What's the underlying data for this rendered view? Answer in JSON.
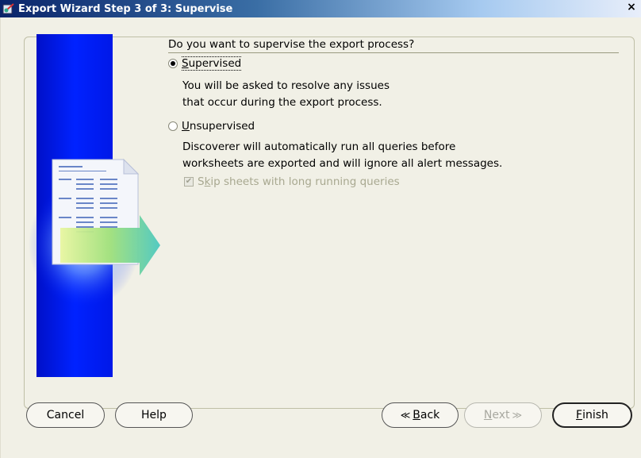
{
  "window": {
    "title": "Export Wizard Step 3 of 3: Supervise",
    "close_label": "×"
  },
  "content": {
    "question": "Do you want to supervise the export process?",
    "options": [
      {
        "label": "Supervised",
        "selected": true,
        "description_lines": [
          "You will be asked to resolve any issues",
          "that occur during the export process."
        ]
      },
      {
        "label": "Unsupervised",
        "selected": false,
        "description_lines": [
          "Discoverer will automatically run all queries before",
          "worksheets are exported and will ignore all alert messages."
        ]
      }
    ],
    "skip_checkbox": {
      "label": "Skip sheets with long running queries",
      "checked": true,
      "enabled": false
    }
  },
  "buttons": {
    "cancel": "Cancel",
    "help": "Help",
    "back": "Back",
    "next": "Next",
    "finish": "Finish"
  }
}
